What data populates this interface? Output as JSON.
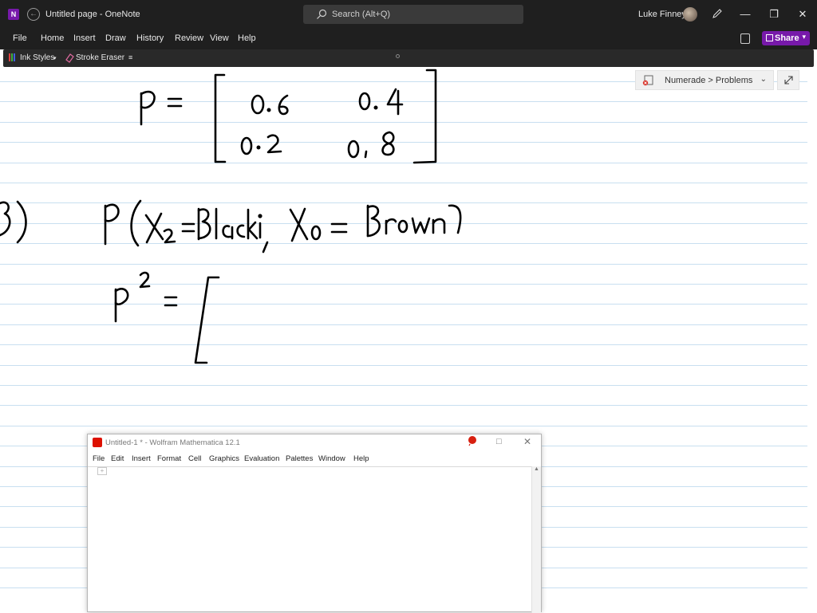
{
  "titlebar": {
    "app_icon_letter": "N",
    "title": "Untitled page  -  OneNote",
    "search_placeholder": "Search (Alt+Q)",
    "user_name": "Luke Finney"
  },
  "menu": [
    "File",
    "Home",
    "Insert",
    "Draw",
    "History",
    "Review",
    "View",
    "Help"
  ],
  "share_label": "Share",
  "toolbar": {
    "ink_styles": "Ink Styles",
    "stroke_eraser": "Stroke Eraser"
  },
  "section": {
    "breadcrumb": "Numerade > Problems"
  },
  "mathematica": {
    "title": "Untitled-1 * - Wolfram Mathematica 12.1",
    "menu": [
      "File",
      "Edit",
      "Insert",
      "Format",
      "Cell",
      "Graphics",
      "Evaluation",
      "Palettes",
      "Window",
      "Help"
    ]
  },
  "colors": {
    "onenote_accent": "#7719aa",
    "titlebar_bg": "#1f1f1f",
    "rule_line": "#c8dff0",
    "ink": "#000000",
    "mathematica_red": "#dd1100"
  },
  "icons": [
    "onenote-icon",
    "back-icon",
    "search-icon",
    "avatar",
    "pen-icon",
    "minimize-icon",
    "restore-icon",
    "close-icon",
    "notebook-icon",
    "share-icon",
    "ink-styles-icon",
    "eraser-icon",
    "section-icon",
    "expand-icon"
  ]
}
